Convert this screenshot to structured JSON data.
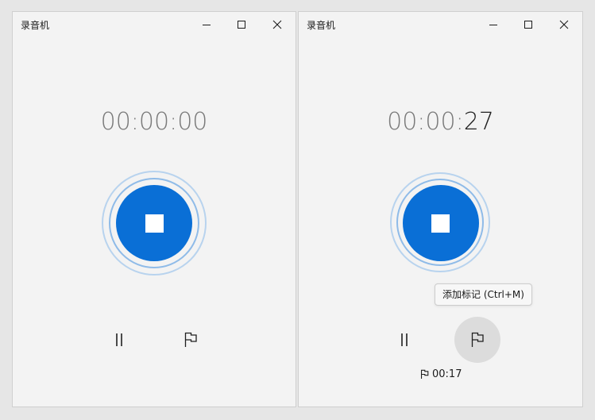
{
  "windows": [
    {
      "title": "录音机",
      "timer": {
        "dim": "00:00:00",
        "active": ""
      }
    },
    {
      "title": "录音机",
      "timer": {
        "dim": "00:00:",
        "active": "27"
      },
      "tooltip": "添加标记 (Ctrl+M)",
      "marker": {
        "time": "00:17"
      }
    }
  ],
  "colors": {
    "accent": "#0a6fd6",
    "ring_outer": "#b8d3ee",
    "ring_inner": "#8fbbe8",
    "window_bg": "#f3f3f3"
  },
  "icons": {
    "minimize": "minimize-icon",
    "maximize": "maximize-icon",
    "close": "close-icon",
    "stop": "stop-icon",
    "pause": "pause-icon",
    "flag": "flag-icon"
  }
}
